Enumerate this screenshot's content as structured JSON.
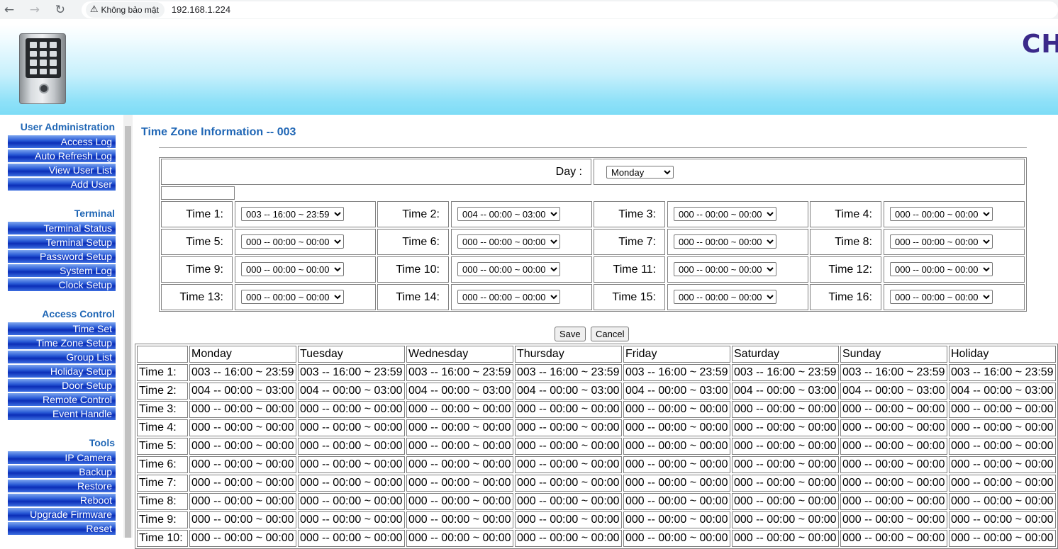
{
  "browser": {
    "security_label": "Không bảo mật",
    "url": "192.168.1.224"
  },
  "header": {
    "brand_text": "CHI"
  },
  "sidebar": {
    "sections": [
      {
        "title": "User Administration",
        "items": [
          "Access Log",
          "Auto Refresh Log",
          "View User List",
          "Add User"
        ]
      },
      {
        "title": "Terminal",
        "items": [
          "Terminal Status",
          "Terminal Setup",
          "Password Setup",
          "System Log",
          "Clock Setup"
        ]
      },
      {
        "title": "Access Control",
        "items": [
          "Time Set",
          "Time Zone Setup",
          "Group List",
          "Holiday Setup",
          "Door Setup",
          "Remote Control",
          "Event Handle"
        ]
      },
      {
        "title": "Tools",
        "items": [
          "IP Camera",
          "Backup",
          "Restore",
          "Reboot",
          "Upgrade Firmware",
          "Reset"
        ]
      }
    ]
  },
  "main": {
    "title": "Time Zone Information -- 003",
    "day_label": "Day :",
    "day_selected": "Monday",
    "time_fields": [
      {
        "label": "Time 1:",
        "value": "003 -- 16:00 ~ 23:59"
      },
      {
        "label": "Time 2:",
        "value": "004 -- 00:00 ~ 03:00"
      },
      {
        "label": "Time 3:",
        "value": "000 -- 00:00 ~ 00:00"
      },
      {
        "label": "Time 4:",
        "value": "000 -- 00:00 ~ 00:00"
      },
      {
        "label": "Time 5:",
        "value": "000 -- 00:00 ~ 00:00"
      },
      {
        "label": "Time 6:",
        "value": "000 -- 00:00 ~ 00:00"
      },
      {
        "label": "Time 7:",
        "value": "000 -- 00:00 ~ 00:00"
      },
      {
        "label": "Time 8:",
        "value": "000 -- 00:00 ~ 00:00"
      },
      {
        "label": "Time 9:",
        "value": "000 -- 00:00 ~ 00:00"
      },
      {
        "label": "Time 10:",
        "value": "000 -- 00:00 ~ 00:00"
      },
      {
        "label": "Time 11:",
        "value": "000 -- 00:00 ~ 00:00"
      },
      {
        "label": "Time 12:",
        "value": "000 -- 00:00 ~ 00:00"
      },
      {
        "label": "Time 13:",
        "value": "000 -- 00:00 ~ 00:00"
      },
      {
        "label": "Time 14:",
        "value": "000 -- 00:00 ~ 00:00"
      },
      {
        "label": "Time 15:",
        "value": "000 -- 00:00 ~ 00:00"
      },
      {
        "label": "Time 16:",
        "value": "000 -- 00:00 ~ 00:00"
      }
    ],
    "save_label": "Save",
    "cancel_label": "Cancel"
  },
  "schedule": {
    "columns": [
      "",
      "Monday",
      "Tuesday",
      "Wednesday",
      "Thursday",
      "Friday",
      "Saturday",
      "Sunday",
      "Holiday"
    ],
    "rows": [
      {
        "label": "Time 1:",
        "value": "003 -- 16:00 ~ 23:59"
      },
      {
        "label": "Time 2:",
        "value": "004 -- 00:00 ~ 03:00"
      },
      {
        "label": "Time 3:",
        "value": "000 -- 00:00 ~ 00:00"
      },
      {
        "label": "Time 4:",
        "value": "000 -- 00:00 ~ 00:00"
      },
      {
        "label": "Time 5:",
        "value": "000 -- 00:00 ~ 00:00"
      },
      {
        "label": "Time 6:",
        "value": "000 -- 00:00 ~ 00:00"
      },
      {
        "label": "Time 7:",
        "value": "000 -- 00:00 ~ 00:00"
      },
      {
        "label": "Time 8:",
        "value": "000 -- 00:00 ~ 00:00"
      },
      {
        "label": "Time 9:",
        "value": "000 -- 00:00 ~ 00:00"
      },
      {
        "label": "Time 10:",
        "value": "000 -- 00:00 ~ 00:00"
      }
    ]
  }
}
